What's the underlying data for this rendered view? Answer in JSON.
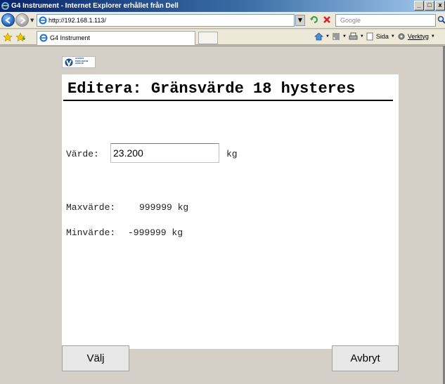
{
  "window": {
    "title": "G4 Instrument - Internet Explorer erhållet från Dell",
    "minimize": "_",
    "maximize": "□",
    "close": "x"
  },
  "navbar": {
    "address": "http://192.168.1.113/",
    "search_placeholder": "Google"
  },
  "tabbar": {
    "tab_label": "G4 Instrument",
    "commands": [
      "Sida",
      "Verktyg"
    ]
  },
  "logo": {
    "text": "VISHAY PRECISION GROUP"
  },
  "page": {
    "title": "Editera: Gränsvärde 18 hysteres",
    "value_label": "Värde:",
    "value": "23.200",
    "value_unit": "kg",
    "max_label": "Maxvärde:",
    "max_value": "999999 kg",
    "min_label": "Minvärde:",
    "min_value": "-999999 kg"
  },
  "buttons": {
    "select": "Välj",
    "cancel": "Avbryt"
  }
}
